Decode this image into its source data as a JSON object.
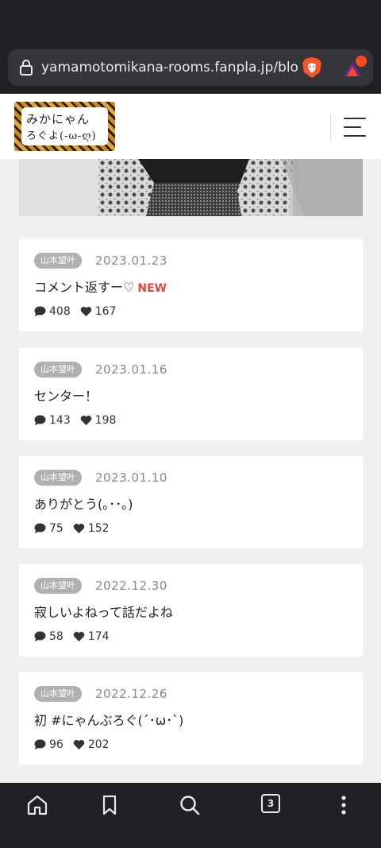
{
  "browser": {
    "url": "yamamotomikana-rooms.fanpla.jp/blo"
  },
  "site": {
    "logo_line1": "みかにゃん",
    "logo_line2": "ろぐよ(-ω-ღ)"
  },
  "posts": [
    {
      "author": "山本望叶",
      "date": "2023.01.23",
      "title": "コメント返すー♡",
      "badge": "NEW",
      "comments": "408",
      "likes": "167"
    },
    {
      "author": "山本望叶",
      "date": "2023.01.16",
      "title": "センター！",
      "comments": "143",
      "likes": "198"
    },
    {
      "author": "山本望叶",
      "date": "2023.01.10",
      "title": "ありがとう(｡･･｡)",
      "comments": "75",
      "likes": "152"
    },
    {
      "author": "山本望叶",
      "date": "2022.12.30",
      "title": "寂しいよねって話だよね",
      "comments": "58",
      "likes": "174"
    },
    {
      "author": "山本望叶",
      "date": "2022.12.26",
      "title": "初 #にゃんぶろぐ(´･ω･`)",
      "comments": "96",
      "likes": "202"
    }
  ],
  "toolbar": {
    "tab_count": "3"
  },
  "colors": {
    "accent_new": "#e24b3b",
    "browser_bg": "#202124",
    "page_bg": "#f0f0f0"
  }
}
